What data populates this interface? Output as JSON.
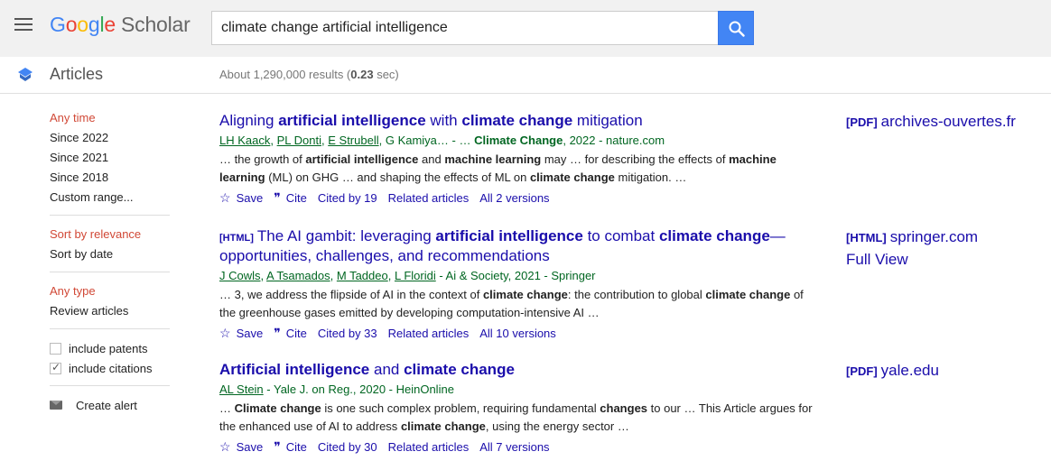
{
  "header": {
    "logo_letters": [
      "G",
      "o",
      "o",
      "g",
      "l",
      "e"
    ],
    "logo_product": "Scholar",
    "search_value": "climate change artificial intelligence"
  },
  "subheader": {
    "section": "Articles",
    "results_prefix": "About 1,290,000 results (",
    "results_time": "0.23",
    "results_suffix": " sec)"
  },
  "sidebar": {
    "time_filters": [
      "Any time",
      "Since 2022",
      "Since 2021",
      "Since 2018",
      "Custom range..."
    ],
    "sort_options": [
      "Sort by relevance",
      "Sort by date"
    ],
    "type_options": [
      "Any type",
      "Review articles"
    ],
    "checkboxes": [
      {
        "label": "include patents",
        "checked": false
      },
      {
        "label": "include citations",
        "checked": true
      }
    ],
    "create_alert": "Create alert"
  },
  "results": [
    {
      "title_parts": [
        [
          "Aligning ",
          false
        ],
        [
          "artificial intelligence",
          true
        ],
        [
          " with ",
          false
        ],
        [
          "climate change",
          true
        ],
        [
          " mitigation",
          false
        ]
      ],
      "tag": "",
      "authors": [
        "LH Kaack",
        "PL Donti",
        "E Strubell"
      ],
      "authors_plain": "G Kamiya",
      "meta_suffix_plain": "… - … ",
      "meta_venue_bold": "Climate Change",
      "meta_tail": ", 2022 - nature.com",
      "snippet_parts": [
        [
          "… the growth of ",
          false
        ],
        [
          "artificial intelligence",
          true
        ],
        [
          " and ",
          false
        ],
        [
          "machine learning",
          true
        ],
        [
          " may … for describing the effects of ",
          false
        ],
        [
          "machine learning",
          true
        ],
        [
          " (ML) on GHG … and shaping the effects of ML on ",
          false
        ],
        [
          "climate change",
          true
        ],
        [
          " mitigation. …",
          false
        ]
      ],
      "actions": {
        "save": "Save",
        "cite": "Cite",
        "cited_by": "Cited by 19",
        "related": "Related articles",
        "versions": "All 2 versions"
      },
      "side": {
        "tag": "[PDF]",
        "label": "archives-ouvertes.fr",
        "extra": ""
      }
    },
    {
      "title_parts": [
        [
          "The AI gambit: leveraging ",
          false
        ],
        [
          "artificial intelligence",
          true
        ],
        [
          " to combat ",
          false
        ],
        [
          "climate change",
          true
        ],
        [
          "—opportunities, challenges, and recommendations",
          false
        ]
      ],
      "tag": "[HTML]",
      "authors": [
        "J Cowls",
        "A Tsamados",
        "M Taddeo",
        "L Floridi"
      ],
      "authors_plain": "",
      "meta_suffix_plain": "",
      "meta_venue_bold": "",
      "meta_tail": " - Ai & Society, 2021 - Springer",
      "snippet_parts": [
        [
          "… 3, we address the flipside of AI in the context of ",
          false
        ],
        [
          "climate change",
          true
        ],
        [
          ": the contribution to global ",
          false
        ],
        [
          "climate change",
          true
        ],
        [
          " of the greenhouse gases emitted by developing computation-intensive AI …",
          false
        ]
      ],
      "actions": {
        "save": "Save",
        "cite": "Cite",
        "cited_by": "Cited by 33",
        "related": "Related articles",
        "versions": "All 10 versions"
      },
      "side": {
        "tag": "[HTML]",
        "label": "springer.com",
        "extra": "Full View"
      }
    },
    {
      "title_parts": [
        [
          "Artificial intelligence",
          true
        ],
        [
          " and ",
          false
        ],
        [
          "climate change",
          true
        ]
      ],
      "tag": "",
      "authors": [
        "AL Stein"
      ],
      "authors_plain": "",
      "meta_suffix_plain": "",
      "meta_venue_bold": "",
      "meta_tail": " - Yale J. on Reg., 2020 - HeinOnline",
      "snippet_parts": [
        [
          "… ",
          false
        ],
        [
          "Climate change",
          true
        ],
        [
          " is one such complex problem, requiring fundamental ",
          false
        ],
        [
          "changes",
          true
        ],
        [
          " to our … This Article argues for the enhanced use of AI to address ",
          false
        ],
        [
          "climate change",
          true
        ],
        [
          ", using the energy sector …",
          false
        ]
      ],
      "actions": {
        "save": "Save",
        "cite": "Cite",
        "cited_by": "Cited by 30",
        "related": "Related articles",
        "versions": "All 7 versions"
      },
      "side": {
        "tag": "[PDF]",
        "label": "yale.edu",
        "extra": ""
      }
    }
  ]
}
